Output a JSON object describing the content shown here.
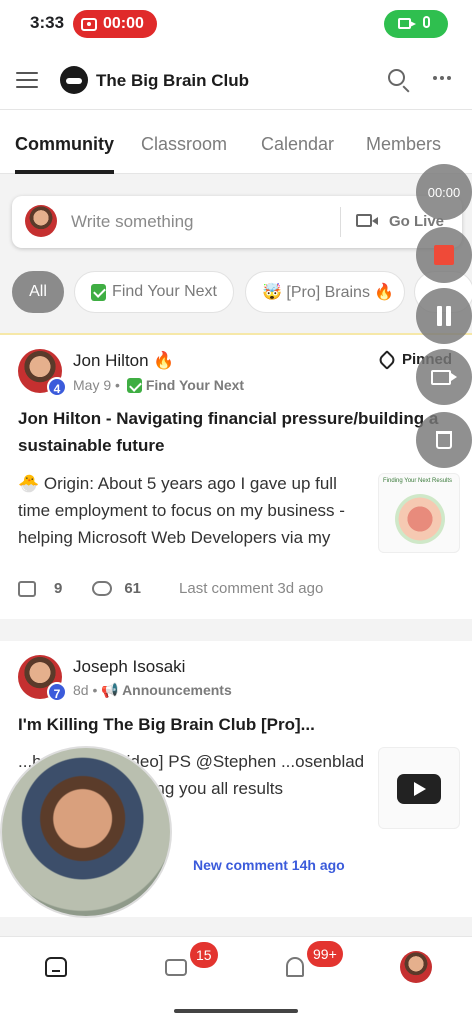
{
  "status": {
    "time": "3:33",
    "recording_time": "00:00"
  },
  "header": {
    "title": "The Big Brain Club"
  },
  "tabs": [
    {
      "label": "Community",
      "active": true
    },
    {
      "label": "Classroom",
      "active": false
    },
    {
      "label": "Calendar",
      "active": false
    },
    {
      "label": "Members",
      "active": false
    }
  ],
  "composer": {
    "placeholder": "Write something",
    "go_live": "Go Live"
  },
  "chips": [
    {
      "label": "All",
      "selected": true
    },
    {
      "label": "Find Your Next",
      "icon": "check-icon"
    },
    {
      "label": "🤯 [Pro] Brains 🔥"
    }
  ],
  "recorder": {
    "timer": "00:00"
  },
  "posts": [
    {
      "author": "Jon Hilton 🔥",
      "level": "4",
      "date": "May 9",
      "category": "Find Your Next",
      "pinned": "Pinned",
      "title": "Jon Hilton - Navigating financial pressure/building a sustainable future",
      "body": "🐣 Origin: About 5 years ago I gave up full time employment to focus on my business - helping Microsoft Web Developers via my",
      "thumb_caption": "Finding Your Next Results",
      "likes": "9",
      "comments": "61",
      "last_comment": "Last comment 3d ago"
    },
    {
      "author": "Joseph Isosaki",
      "level": "7",
      "date": "8d",
      "category": "📢 Announcements",
      "title": "I'm Killing The Big Brain Club [Pro]...",
      "body": "...h... [Check video] PS @Stephen ...osenblad James . I'm ...getting you all results",
      "new_comment": "New comment 14h ago"
    }
  ],
  "bottom_nav": {
    "chat_badge": "15",
    "notif_badge": "99+"
  },
  "colors": {
    "accent_red": "#e3342f",
    "level_blue": "#3b5bdb",
    "check_green": "#3fae43"
  }
}
